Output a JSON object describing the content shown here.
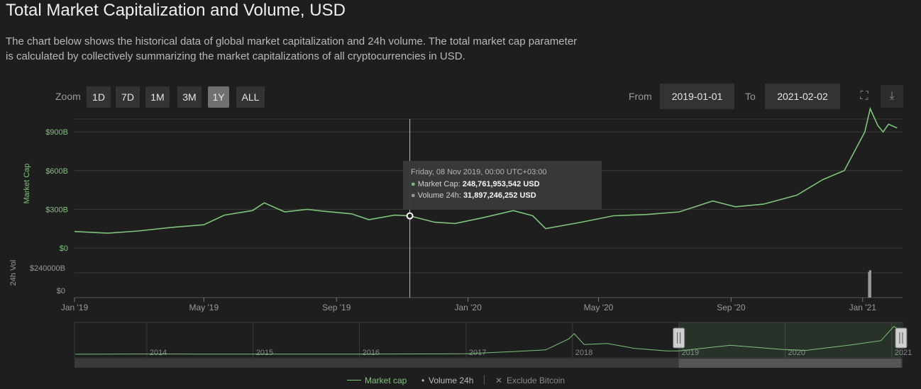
{
  "title": "Total Market Capitalization and Volume, USD",
  "description": "The chart below shows the historical data of global market capitalization and 24h volume. The total market cap parameter is calculated by collectively summarizing the market capitalizations of all cryptocurrencies in USD.",
  "zoom": {
    "label": "Zoom",
    "buttons": [
      "1D",
      "7D",
      "1M",
      "3M",
      "1Y",
      "ALL"
    ],
    "active": "1Y"
  },
  "range": {
    "from_label": "From",
    "from_value": "2019-01-01",
    "to_label": "To",
    "to_value": "2021-02-02"
  },
  "icons": {
    "fullscreen": "fullscreen-icon",
    "download": "download-icon"
  },
  "colors": {
    "market_cap": "#7ec47a",
    "volume": "#9a9a9a",
    "background": "#1e1e1e"
  },
  "tooltip": {
    "date": "Friday, 08 Nov 2019, 00:00 UTC+03:00",
    "mcap_label": "Market Cap:",
    "mcap_value": "248,761,953,542 USD",
    "vol_label": "Volume 24h:",
    "vol_value": "31,897,246,252 USD"
  },
  "legend": {
    "market_cap": "Market cap",
    "volume": "Volume 24h",
    "exclude": "Exclude Bitcoin"
  },
  "chart_data": {
    "type": "line",
    "xlabel": "",
    "ylabel": "Market Cap",
    "y2label": "24h Vol",
    "x_ticks": [
      "Jan '19",
      "May '19",
      "Sep '19",
      "Jan '20",
      "May '20",
      "Sep '20",
      "Jan '21"
    ],
    "y_ticks": [
      "$0",
      "$300B",
      "$600B",
      "$900B"
    ],
    "ylim": [
      0,
      1000
    ],
    "vol_ticks": [
      "$0",
      "$240000B"
    ],
    "navigator_labels": [
      "2014",
      "2015",
      "2016",
      "2017",
      "2018",
      "2019",
      "2020",
      "2021"
    ],
    "series": [
      {
        "name": "Market cap",
        "unit": "billion USD",
        "points": [
          [
            "2019-01-01",
            128
          ],
          [
            "2019-02-01",
            115
          ],
          [
            "2019-03-01",
            132
          ],
          [
            "2019-04-01",
            160
          ],
          [
            "2019-05-01",
            180
          ],
          [
            "2019-05-20",
            255
          ],
          [
            "2019-06-15",
            290
          ],
          [
            "2019-06-26",
            350
          ],
          [
            "2019-07-15",
            280
          ],
          [
            "2019-08-05",
            300
          ],
          [
            "2019-08-20",
            285
          ],
          [
            "2019-09-15",
            265
          ],
          [
            "2019-10-01",
            220
          ],
          [
            "2019-10-25",
            255
          ],
          [
            "2019-11-08",
            249
          ],
          [
            "2019-12-01",
            200
          ],
          [
            "2019-12-20",
            190
          ],
          [
            "2020-01-15",
            235
          ],
          [
            "2020-02-12",
            290
          ],
          [
            "2020-03-01",
            250
          ],
          [
            "2020-03-13",
            150
          ],
          [
            "2020-04-15",
            200
          ],
          [
            "2020-05-15",
            250
          ],
          [
            "2020-06-15",
            260
          ],
          [
            "2020-07-15",
            280
          ],
          [
            "2020-08-15",
            365
          ],
          [
            "2020-09-05",
            320
          ],
          [
            "2020-10-01",
            340
          ],
          [
            "2020-11-01",
            410
          ],
          [
            "2020-11-25",
            530
          ],
          [
            "2020-12-15",
            600
          ],
          [
            "2021-01-03",
            900
          ],
          [
            "2021-01-08",
            1080
          ],
          [
            "2021-01-15",
            950
          ],
          [
            "2021-01-20",
            900
          ],
          [
            "2021-01-25",
            960
          ],
          [
            "2021-02-02",
            930
          ]
        ]
      },
      {
        "name": "Volume 24h",
        "unit": "billion USD",
        "points": [
          [
            "2021-01-07",
            250000
          ],
          [
            "2021-01-08",
            265000
          ]
        ]
      }
    ]
  }
}
